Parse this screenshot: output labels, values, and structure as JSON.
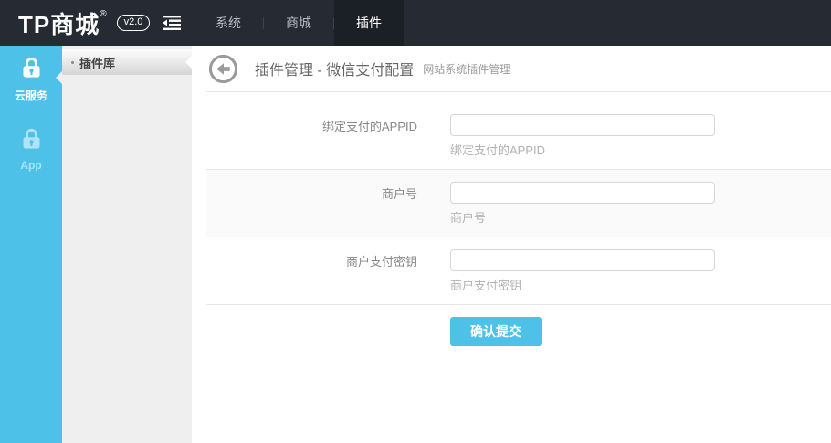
{
  "header": {
    "logo": "TP商城",
    "logo_reg": "®",
    "version_badge": "v2.0",
    "nav": [
      {
        "label": "系统",
        "active": false
      },
      {
        "label": "商城",
        "active": false
      },
      {
        "label": "插件",
        "active": true
      }
    ]
  },
  "sidebar": {
    "items": [
      {
        "label": "云服务",
        "active": true
      },
      {
        "label": "App",
        "active": false
      }
    ]
  },
  "submenu": {
    "items": [
      {
        "label": "插件库",
        "active": true
      }
    ]
  },
  "page": {
    "title": "插件管理 - 微信支付配置",
    "subtitle": "网站系统插件管理"
  },
  "form": {
    "fields": [
      {
        "label": "绑定支付的APPID",
        "value": "",
        "help": "绑定支付的APPID"
      },
      {
        "label": "商户号",
        "value": "",
        "help": "商户号"
      },
      {
        "label": "商户支付密钥",
        "value": "",
        "help": "商户支付密钥"
      }
    ],
    "submit_label": "确认提交"
  },
  "colors": {
    "accent_blue": "#4ec1e9",
    "header_bg": "#262a33",
    "header_active_tab_bg": "#1b1f26",
    "submenu_bg": "#efefef",
    "row_alt_bg": "#fafafa"
  }
}
